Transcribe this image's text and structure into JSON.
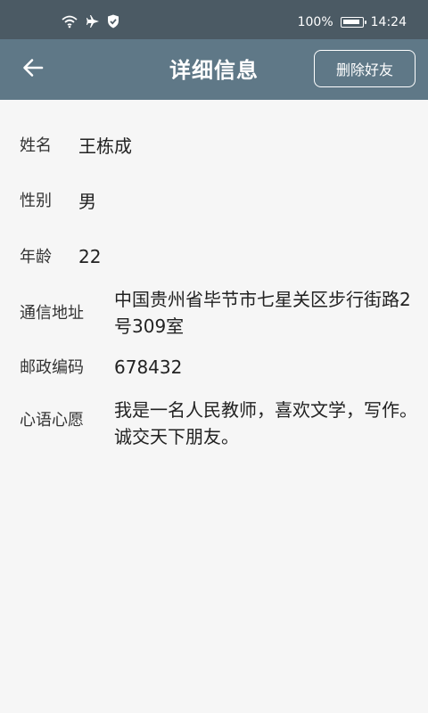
{
  "status_bar": {
    "battery_text": "100%",
    "battery_level": 1.0,
    "time": "14:24",
    "icons": [
      "wifi-icon",
      "airplane-icon",
      "shield-check-icon",
      "battery-icon"
    ]
  },
  "app_bar": {
    "back_icon": "arrow-left-icon",
    "title": "详细信息",
    "delete_button_label": "删除好友"
  },
  "details": {
    "name": {
      "label": "姓名",
      "value": "王栋成"
    },
    "gender": {
      "label": "性别",
      "value": "男"
    },
    "age": {
      "label": "年龄",
      "value": "22"
    },
    "address": {
      "label": "通信地址",
      "value": "中国贵州省毕节市七星关区步行街路2号309室"
    },
    "postal_code": {
      "label": "邮政编码",
      "value": "678432"
    },
    "wish": {
      "label": "心语心愿",
      "value": "我是一名人民教师，喜欢文学，写作。诚交天下朋友。"
    }
  },
  "colors": {
    "status_bar_bg": "#4b5a64",
    "app_bar_bg": "#5f7887",
    "page_bg": "#f6f6f6"
  }
}
